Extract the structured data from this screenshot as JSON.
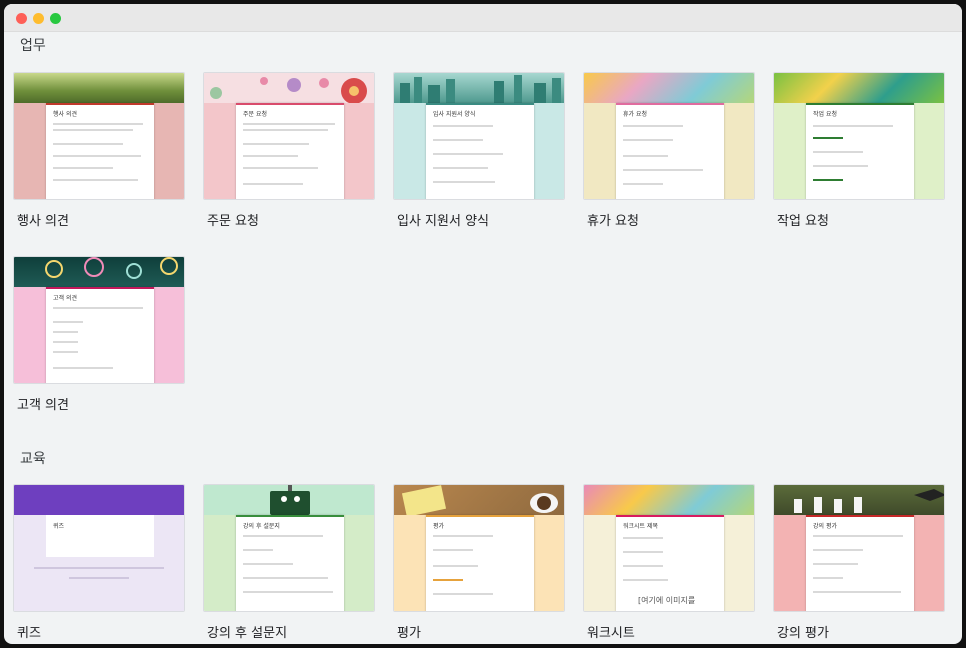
{
  "sections": [
    {
      "title": "업무"
    },
    {
      "title": "교육"
    }
  ],
  "cards": [
    {
      "label": "행사 의견",
      "paper_title": "행사 의견",
      "banner": "#7d9a4a",
      "lower": "#e7b6b3",
      "accent": "#c0392b"
    },
    {
      "label": "주문 요청",
      "paper_title": "주문 요청",
      "banner": "#f6dfe2",
      "lower": "#f3c6ca",
      "accent": "#d94b6c"
    },
    {
      "label": "입사 지원서 양식",
      "paper_title": "입사 지원서 양식",
      "banner": "#4f9a8f",
      "lower": "#c9e8e6",
      "accent": "#3a8b82"
    },
    {
      "label": "휴가 요청",
      "paper_title": "휴가 요청",
      "banner": "#e9a7c4",
      "lower": "#f1e8c2",
      "accent": "#e06c9f"
    },
    {
      "label": "작업 요청",
      "paper_title": "작업 요청",
      "banner": "#7ac142",
      "lower": "#dff0c8",
      "accent": "#2e7d32"
    },
    {
      "label": "고객 의견",
      "paper_title": "고객 의견",
      "banner": "#1f5b55",
      "lower": "#f6bfd9",
      "accent": "#c2185b"
    },
    {
      "label": "퀴즈",
      "paper_title": "퀴즈",
      "banner": "#6e3fbf",
      "lower": "#ece6f5",
      "accent": "#6e3fbf"
    },
    {
      "label": "강의 후 설문지",
      "paper_title": "강의 후 설문지",
      "banner": "#bfe8cf",
      "lower": "#d4ecc8",
      "accent": "#388e3c"
    },
    {
      "label": "평가",
      "paper_title": "평가",
      "banner": "#b9874e",
      "lower": "#fce3b6",
      "accent": "#e6a23c"
    },
    {
      "label": "워크시트",
      "paper_title": "워크시트 제목",
      "banner": "#e98ab7",
      "lower": "#f5f0d8",
      "accent": "#d81b60"
    },
    {
      "label": "강의 평가",
      "paper_title": "강의 평가",
      "banner": "#5b6b3a",
      "lower": "#f3b3b3",
      "accent": "#c62828"
    }
  ],
  "quiz_paper_subtitle": "퀴즈",
  "worksheet_text": "[여기에 이미지를",
  "colors": {
    "background": "#f1f3f4",
    "titlebar": "#e8e8e8"
  }
}
